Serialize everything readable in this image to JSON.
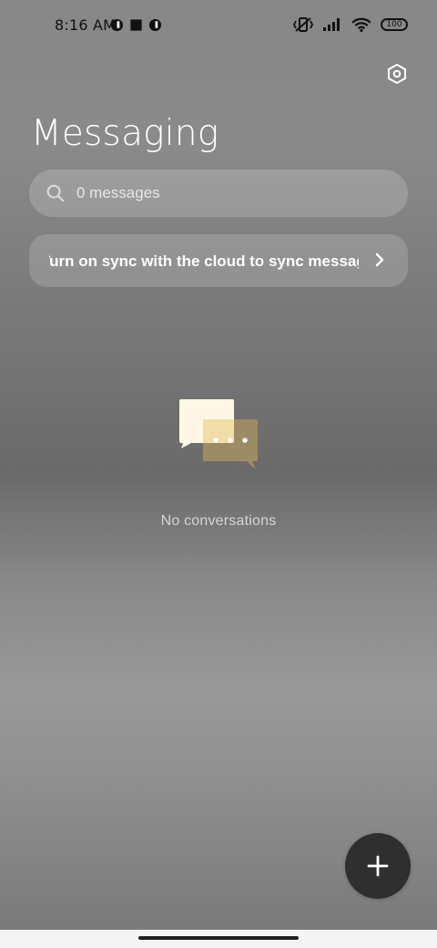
{
  "status_bar": {
    "time": "8:16 AM",
    "battery": "100",
    "left_icons": [
      "notification-circle-icon",
      "square-app-icon",
      "notification-circle-icon"
    ],
    "right_icons": [
      "vibrate-off-icon",
      "signal-icon",
      "wifi-icon",
      "battery-icon"
    ]
  },
  "header": {
    "title": "Messaging",
    "settings_icon": "settings-hex-icon"
  },
  "search": {
    "placeholder": "0 messages",
    "value": ""
  },
  "sync_banner": {
    "text": "Turn on sync with the cloud to sync messages"
  },
  "empty_state": {
    "text": "No conversations"
  },
  "fab": {
    "icon": "plus-icon"
  },
  "colors": {
    "title": "#ffffff",
    "fab_bg": "#2f2f2f",
    "chat_bubble_front": "#fff7e8",
    "chat_bubble_back": "#9c8b66"
  }
}
